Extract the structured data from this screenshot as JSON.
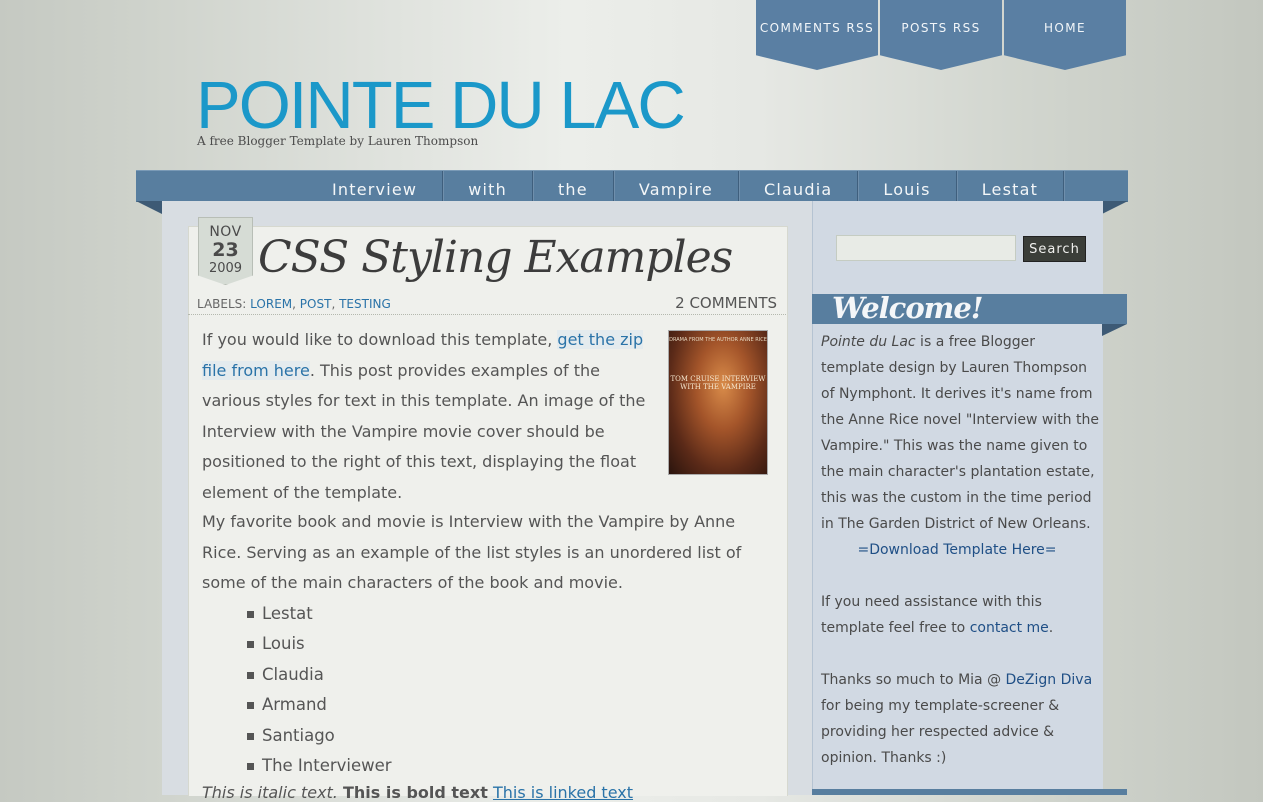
{
  "top_links": [
    "COMMENTS RSS",
    "POSTS RSS",
    "HOME"
  ],
  "site": {
    "title": "POINTE DU LAC",
    "description": "A free Blogger Template by Lauren Thompson"
  },
  "nav": [
    "Interview",
    "with",
    "the",
    "Vampire",
    "Claudia",
    "Louis",
    "Lestat"
  ],
  "post": {
    "date": {
      "month": "NOV",
      "day": "23",
      "year": "2009"
    },
    "title": "CSS Styling Examples",
    "labels_prefix": "LABELS:",
    "labels": [
      "LOREM",
      "POST",
      "TESTING"
    ],
    "comments": "2 COMMENTS",
    "p1_before": "If you would like to download this template, ",
    "p1_link": "get the zip file from here",
    "p1_after": ". This post provides examples of the various styles for text in this template. An image of the Interview with the Vampire movie cover should be positioned to the right of this text, displaying the float element of the template.",
    "cover": {
      "small": "DRAMA FROM THE AUTHOR ANNE RICE",
      "caption": "TOM CRUISE INTERVIEW WITH THE VAMPIRE"
    },
    "p2": "My favorite book and movie is Interview with the Vampire by Anne Rice. Serving as an example of the list styles is an unordered list of some of the main characters of the book and movie.",
    "list": [
      "Lestat",
      "Louis",
      "Claudia",
      "Armand",
      "Santiago",
      "The Interviewer"
    ],
    "italic": "This is italic text.",
    "bold": "This is bold text",
    "link": "This is linked text"
  },
  "search": {
    "button": "Search",
    "placeholder": ""
  },
  "widget": {
    "title": "Welcome!",
    "intro_em": "Pointe du Lac",
    "intro": " is a free Blogger template design by Lauren Thompson of Nymphont. It derives it's name from the Anne Rice novel \"Interview with the Vampire.\" This was the name given to the main character's plantation estate, this was the custom in the time period in The Garden District of New Orleans.",
    "download": "=Download Template Here=",
    "help_before": "If you need assistance with this template feel free to ",
    "help_link": "contact me",
    "help_after": ".",
    "thanks_before": "Thanks so much to Mia @ ",
    "thanks_link": "DeZign Diva",
    "thanks_after": " for being my template-screener & providing her respected advice & opinion. Thanks :)"
  },
  "colors": {
    "accent": "#1b98c9",
    "nav": "#587e9f",
    "link": "#2a73a8"
  }
}
